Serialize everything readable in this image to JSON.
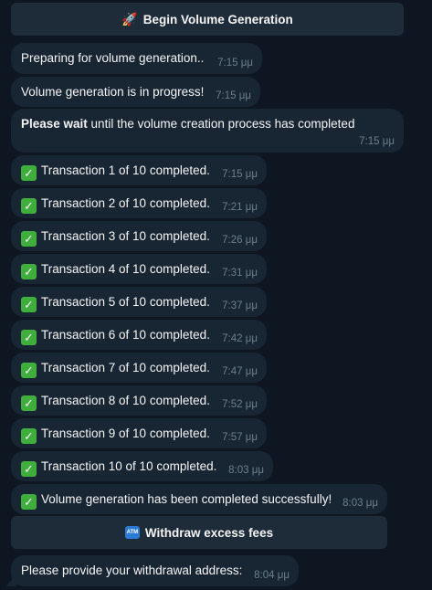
{
  "buttons": {
    "begin": {
      "icon": "🚀",
      "label": "Begin Volume Generation"
    },
    "withdraw": {
      "icon": "ATM",
      "label": "Withdraw excess fees"
    }
  },
  "messages": [
    {
      "text": "Preparing for volume generation..",
      "time": "7:15 μμ"
    },
    {
      "text": "Volume generation is in progress!",
      "time": "7:15 μμ"
    },
    {
      "bold": "Please wait",
      "text": " until the volume creation process has completed",
      "time": "7:15 μμ"
    },
    {
      "check": "✓",
      "text": "Transaction 1 of 10 completed.",
      "time": "7:15 μμ"
    },
    {
      "check": "✓",
      "text": "Transaction 2 of 10 completed.",
      "time": "7:21 μμ"
    },
    {
      "check": "✓",
      "text": "Transaction 3 of 10 completed.",
      "time": "7:26 μμ"
    },
    {
      "check": "✓",
      "text": "Transaction 4 of 10 completed.",
      "time": "7:31 μμ"
    },
    {
      "check": "✓",
      "text": "Transaction 5 of 10 completed.",
      "time": "7:37 μμ"
    },
    {
      "check": "✓",
      "text": "Transaction 6 of 10 completed.",
      "time": "7:42 μμ"
    },
    {
      "check": "✓",
      "text": "Transaction 7 of 10 completed.",
      "time": "7:47 μμ"
    },
    {
      "check": "✓",
      "text": "Transaction 8 of 10 completed.",
      "time": "7:52 μμ"
    },
    {
      "check": "✓",
      "text": "Transaction 9 of 10 completed.",
      "time": "7:57 μμ"
    },
    {
      "check": "✓",
      "text": "Transaction 10 of 10 completed.",
      "time": "8:03 μμ"
    },
    {
      "check": "✓",
      "text": "Volume generation has been completed successfully!",
      "time": "8:03 μμ"
    },
    {
      "text": "Please provide your withdrawal address:",
      "time": "8:04 μμ"
    }
  ]
}
